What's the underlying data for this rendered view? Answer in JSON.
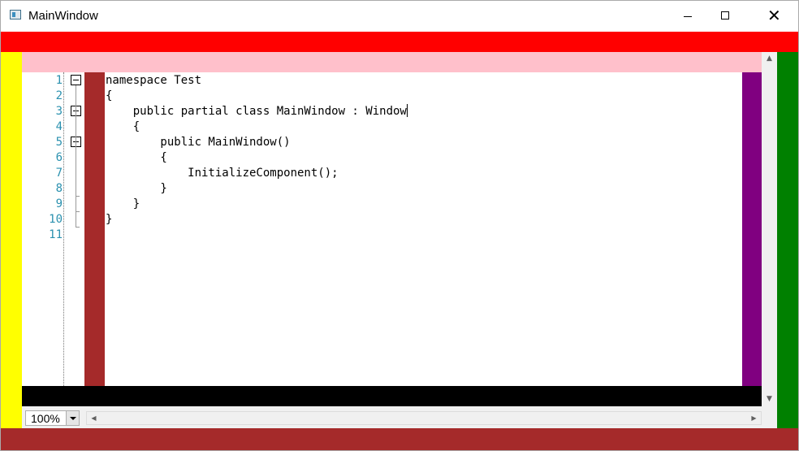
{
  "window": {
    "title": "MainWindow",
    "icon": "app-window-icon",
    "controls": {
      "minimize": "minimize-icon",
      "maximize": "maximize-icon",
      "close": "close-icon"
    },
    "close_glyph": "✕"
  },
  "colors": {
    "top_band": "#ff0000",
    "left_band": "#ffff00",
    "right_band": "#008000",
    "bottom_band": "#a52a2a",
    "header_band": "#ffc0cb",
    "footer_band": "#000000",
    "left_margin_strip": "#a52a2a",
    "right_margin_strip": "#800080",
    "line_number_color": "#2b91af"
  },
  "editor": {
    "line_numbers": [
      "1",
      "2",
      "3",
      "4",
      "5",
      "6",
      "7",
      "8",
      "9",
      "10",
      "11"
    ],
    "lines": [
      "namespace Test",
      "{",
      "    public partial class MainWindow : Window",
      "    {",
      "        public MainWindow()",
      "        {",
      "            InitializeComponent();",
      "        }",
      "    }",
      "}",
      ""
    ],
    "caret_line": 3
  },
  "vertical_scrollbar": {
    "up_glyph": "▲",
    "down_glyph": "▼"
  },
  "status": {
    "zoom_value": "100%",
    "hscroll_left_glyph": "◀",
    "hscroll_right_glyph": "▶"
  }
}
